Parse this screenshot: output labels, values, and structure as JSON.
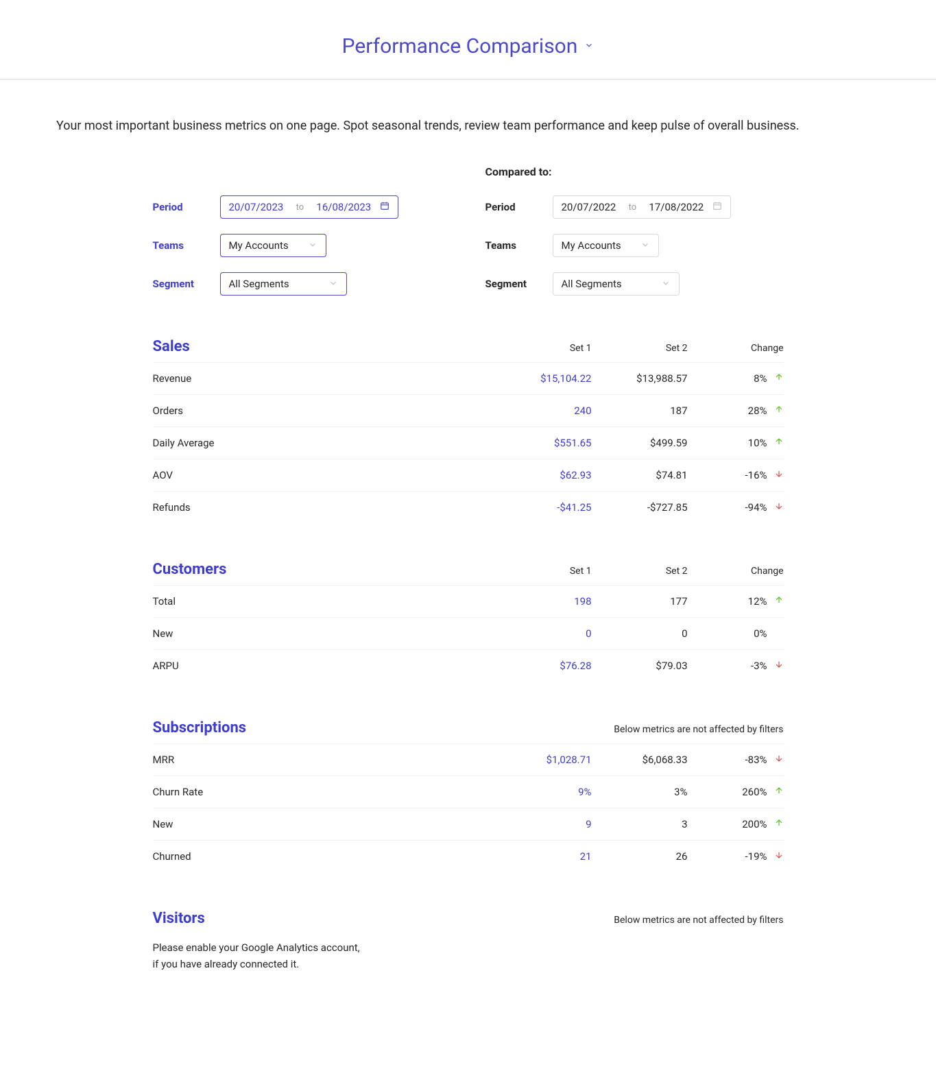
{
  "header": {
    "title": "Performance Comparison"
  },
  "intro": "Your most important business metrics on one page. Spot seasonal trends, review team performance and keep pulse of overall business.",
  "filters": {
    "compared_title": "Compared to:",
    "labels": {
      "period": "Period",
      "teams": "Teams",
      "segment": "Segment",
      "to": "to"
    },
    "primary": {
      "date_from": "20/07/2023",
      "date_to": "16/08/2023",
      "teams": "My Accounts",
      "segment": "All Segments"
    },
    "compare": {
      "date_from": "20/07/2022",
      "date_to": "17/08/2022",
      "teams": "My Accounts",
      "segment": "All Segments"
    }
  },
  "columns": {
    "set1": "Set 1",
    "set2": "Set 2",
    "change": "Change"
  },
  "notes": {
    "not_affected": "Below metrics are not affected by filters",
    "ga_line1": "Please enable your Google Analytics account,",
    "ga_line2": "if you have already connected it."
  },
  "sections": {
    "sales": {
      "title": "Sales",
      "rows": [
        {
          "label": "Revenue",
          "set1": "$15,104.22",
          "set2": "$13,988.57",
          "change": "8%",
          "dir": "up"
        },
        {
          "label": "Orders",
          "set1": "240",
          "set2": "187",
          "change": "28%",
          "dir": "up"
        },
        {
          "label": "Daily Average",
          "set1": "$551.65",
          "set2": "$499.59",
          "change": "10%",
          "dir": "up"
        },
        {
          "label": "AOV",
          "set1": "$62.93",
          "set2": "$74.81",
          "change": "-16%",
          "dir": "down"
        },
        {
          "label": "Refunds",
          "set1": "-$41.25",
          "set2": "-$727.85",
          "change": "-94%",
          "dir": "down"
        }
      ]
    },
    "customers": {
      "title": "Customers",
      "rows": [
        {
          "label": "Total",
          "set1": "198",
          "set2": "177",
          "change": "12%",
          "dir": "up"
        },
        {
          "label": "New",
          "set1": "0",
          "set2": "0",
          "change": "0%",
          "dir": "none"
        },
        {
          "label": "ARPU",
          "set1": "$76.28",
          "set2": "$79.03",
          "change": "-3%",
          "dir": "down"
        }
      ]
    },
    "subscriptions": {
      "title": "Subscriptions",
      "rows": [
        {
          "label": "MRR",
          "set1": "$1,028.71",
          "set2": "$6,068.33",
          "change": "-83%",
          "dir": "down"
        },
        {
          "label": "Churn Rate",
          "set1": "9%",
          "set2": "3%",
          "change": "260%",
          "dir": "up"
        },
        {
          "label": "New",
          "set1": "9",
          "set2": "3",
          "change": "200%",
          "dir": "up"
        },
        {
          "label": "Churned",
          "set1": "21",
          "set2": "26",
          "change": "-19%",
          "dir": "down"
        }
      ]
    },
    "visitors": {
      "title": "Visitors"
    }
  }
}
